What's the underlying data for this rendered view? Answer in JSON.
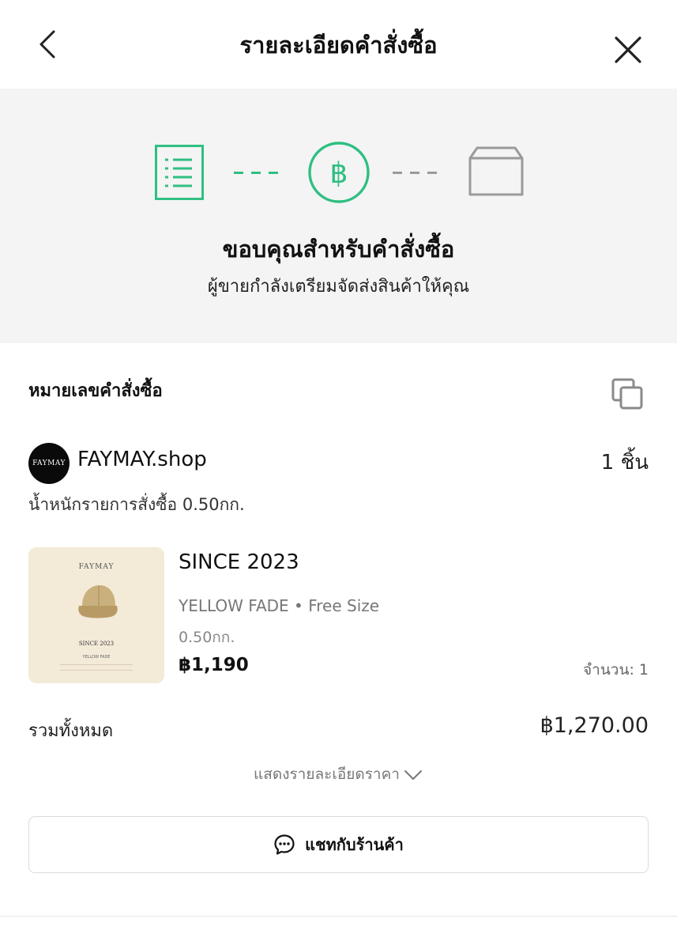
{
  "header": {
    "title": "รายละเอียดคำสั่งซื้อ",
    "back_icon": "chevron-left-icon",
    "close_icon": "close-icon"
  },
  "progress": {
    "steps": [
      {
        "icon": "order-list-icon",
        "state": "done"
      },
      {
        "icon": "baht-coin-icon",
        "state": "current"
      },
      {
        "icon": "package-box-icon",
        "state": "pending"
      }
    ],
    "colors": {
      "active": "#2fbf82",
      "inactive": "#9a9a9a"
    },
    "heading": "ขอบคุณสำหรับคำสั่งซื้อ",
    "subheading": "ผู้ขายกำลังเตรียมจัดส่งสินค้าให้คุณ"
  },
  "order": {
    "number_label": "หมายเลขคำสั่งซื้อ",
    "copy_icon": "copy-icon"
  },
  "shop": {
    "avatar_text": "FAYMAY",
    "name": "FAYMAY.shop",
    "item_count": "1 ชิ้น",
    "weight_line": "น้ำหนักรายการสั่งซื้อ 0.50กก."
  },
  "product": {
    "image": {
      "brand": "FAYMAY",
      "title": "SINCE 2023",
      "variant": "YELLOW FADE"
    },
    "name": "SINCE 2023",
    "variant": "YELLOW FADE • Free Size",
    "weight": "0.50กก.",
    "price": "฿1,190",
    "quantity": "จำนวน: 1"
  },
  "summary": {
    "total_label": "รวมทั้งหมด",
    "total_value": "฿1,270.00",
    "details_toggle": "แสดงรายละเอียดราคา"
  },
  "actions": {
    "chat_label": "แชทกับร้านค้า",
    "chat_icon": "chat-bubble-icon"
  }
}
